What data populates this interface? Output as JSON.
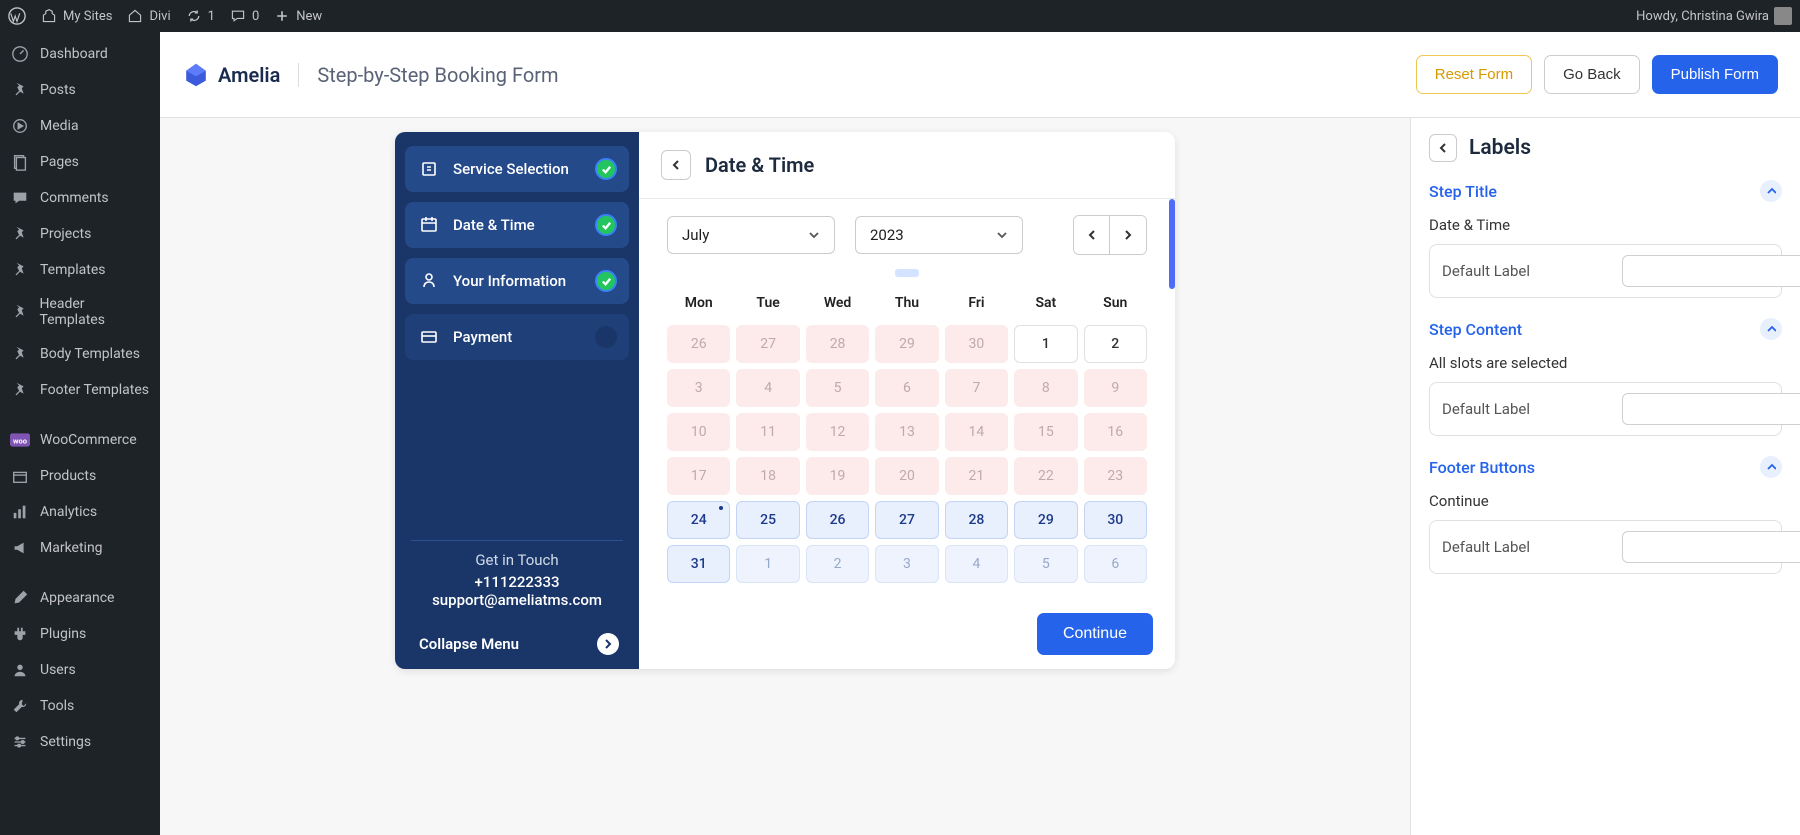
{
  "wp_toolbar": {
    "my_sites": "My Sites",
    "site_name": "Divi",
    "updates": "1",
    "comments": "0",
    "new": "New",
    "howdy": "Howdy, Christina Gwira"
  },
  "wp_sidebar": [
    {
      "label": "Dashboard",
      "icon": "dashboard"
    },
    {
      "label": "Posts",
      "icon": "pin"
    },
    {
      "label": "Media",
      "icon": "media"
    },
    {
      "label": "Pages",
      "icon": "pages"
    },
    {
      "label": "Comments",
      "icon": "comment"
    },
    {
      "label": "Projects",
      "icon": "pin"
    },
    {
      "label": "Templates",
      "icon": "pin"
    },
    {
      "label": "Header Templates",
      "icon": "pin"
    },
    {
      "label": "Body Templates",
      "icon": "pin"
    },
    {
      "label": "Footer Templates",
      "icon": "pin"
    },
    {
      "label": "WooCommerce",
      "icon": "woo",
      "sep_before": true
    },
    {
      "label": "Products",
      "icon": "products"
    },
    {
      "label": "Analytics",
      "icon": "analytics"
    },
    {
      "label": "Marketing",
      "icon": "marketing"
    },
    {
      "label": "Appearance",
      "icon": "brush",
      "sep_before": true
    },
    {
      "label": "Plugins",
      "icon": "plugin"
    },
    {
      "label": "Users",
      "icon": "users"
    },
    {
      "label": "Tools",
      "icon": "tools"
    },
    {
      "label": "Settings",
      "icon": "settings"
    }
  ],
  "topbar": {
    "brand": "Amelia",
    "subtitle": "Step-by-Step Booking Form",
    "reset": "Reset Form",
    "go_back": "Go Back",
    "publish": "Publish Form"
  },
  "steps": [
    {
      "label": "Service Selection",
      "done": true
    },
    {
      "label": "Date & Time",
      "done": true
    },
    {
      "label": "Your Information",
      "done": true
    },
    {
      "label": "Payment",
      "done": false
    }
  ],
  "contact": {
    "title": "Get in Touch",
    "phone": "+111222333",
    "email": "support@ameliatms.com"
  },
  "collapse": "Collapse Menu",
  "form": {
    "title": "Date & Time",
    "month": "July",
    "year": "2023",
    "dow": [
      "Mon",
      "Tue",
      "Wed",
      "Thu",
      "Fri",
      "Sat",
      "Sun"
    ],
    "weeks": [
      [
        {
          "n": "26",
          "t": "disabled"
        },
        {
          "n": "27",
          "t": "disabled"
        },
        {
          "n": "28",
          "t": "disabled"
        },
        {
          "n": "29",
          "t": "disabled"
        },
        {
          "n": "30",
          "t": "disabled"
        },
        {
          "n": "1",
          "t": "plain"
        },
        {
          "n": "2",
          "t": "plain"
        }
      ],
      [
        {
          "n": "3",
          "t": "disabled"
        },
        {
          "n": "4",
          "t": "disabled"
        },
        {
          "n": "5",
          "t": "disabled"
        },
        {
          "n": "6",
          "t": "disabled"
        },
        {
          "n": "7",
          "t": "disabled"
        },
        {
          "n": "8",
          "t": "disabled"
        },
        {
          "n": "9",
          "t": "disabled"
        }
      ],
      [
        {
          "n": "10",
          "t": "disabled"
        },
        {
          "n": "11",
          "t": "disabled"
        },
        {
          "n": "12",
          "t": "disabled"
        },
        {
          "n": "13",
          "t": "disabled"
        },
        {
          "n": "14",
          "t": "disabled"
        },
        {
          "n": "15",
          "t": "disabled"
        },
        {
          "n": "16",
          "t": "disabled"
        }
      ],
      [
        {
          "n": "17",
          "t": "disabled"
        },
        {
          "n": "18",
          "t": "disabled"
        },
        {
          "n": "19",
          "t": "disabled"
        },
        {
          "n": "20",
          "t": "disabled"
        },
        {
          "n": "21",
          "t": "disabled"
        },
        {
          "n": "22",
          "t": "disabled"
        },
        {
          "n": "23",
          "t": "disabled"
        }
      ],
      [
        {
          "n": "24",
          "t": "avail",
          "dot": true
        },
        {
          "n": "25",
          "t": "avail"
        },
        {
          "n": "26",
          "t": "avail"
        },
        {
          "n": "27",
          "t": "avail"
        },
        {
          "n": "28",
          "t": "avail"
        },
        {
          "n": "29",
          "t": "avail"
        },
        {
          "n": "30",
          "t": "avail"
        }
      ],
      [
        {
          "n": "31",
          "t": "avail"
        },
        {
          "n": "1",
          "t": "next"
        },
        {
          "n": "2",
          "t": "next"
        },
        {
          "n": "3",
          "t": "next"
        },
        {
          "n": "4",
          "t": "next"
        },
        {
          "n": "5",
          "t": "next"
        },
        {
          "n": "6",
          "t": "next"
        }
      ]
    ],
    "continue": "Continue"
  },
  "rpanel": {
    "title": "Labels",
    "sections": {
      "step_title": {
        "header": "Step Title",
        "label": "Date & Time",
        "default": "Default Label"
      },
      "step_content": {
        "header": "Step Content",
        "label": "All slots are selected",
        "default": "Default Label"
      },
      "footer_buttons": {
        "header": "Footer Buttons",
        "label": "Continue",
        "default": "Default Label"
      }
    }
  }
}
